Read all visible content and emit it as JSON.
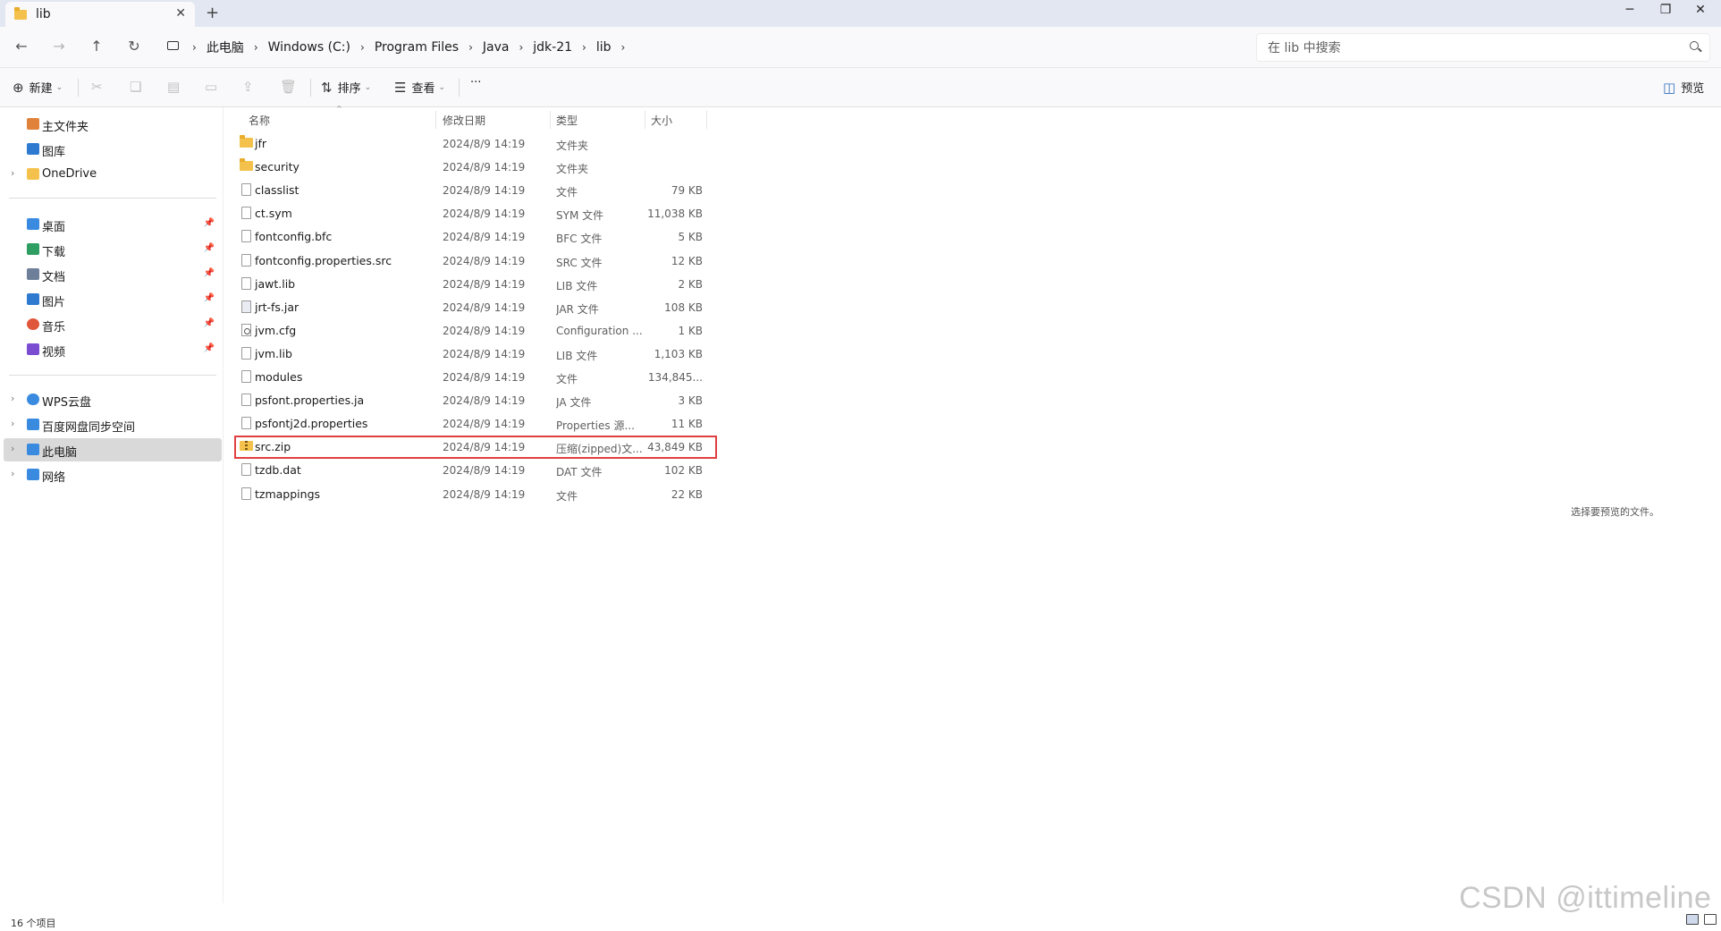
{
  "window": {
    "tab_title": "lib",
    "tab_close": "✕",
    "new_tab": "+",
    "minimize": "─",
    "restore": "❐",
    "close": "✕"
  },
  "address": {
    "crumbs": [
      "此电脑",
      "Windows (C:)",
      "Program Files",
      "Java",
      "jdk-21",
      "lib"
    ],
    "separator": "›",
    "search_placeholder": "在 lib 中搜索"
  },
  "toolbar": {
    "new_label": "新建",
    "sort_label": "排序",
    "view_label": "查看",
    "more_label": "···",
    "preview_label": "预览"
  },
  "sidebar": {
    "top_items": [
      {
        "label": "主文件夹",
        "icon": "home-icon",
        "color": "#e0823a"
      },
      {
        "label": "图库",
        "icon": "gallery-icon",
        "color": "#2f7ad1"
      },
      {
        "label": "OneDrive",
        "icon": "folder-icon",
        "color": "#f4c24c"
      }
    ],
    "pinned_items": [
      {
        "label": "桌面",
        "icon": "desktop-icon",
        "color": "#3a8be0"
      },
      {
        "label": "下载",
        "icon": "download-icon",
        "color": "#2e9e62"
      },
      {
        "label": "文档",
        "icon": "documents-icon",
        "color": "#6d7f99"
      },
      {
        "label": "图片",
        "icon": "pictures-icon",
        "color": "#2f7ad1"
      },
      {
        "label": "音乐",
        "icon": "music-icon",
        "color": "#e0563a"
      },
      {
        "label": "视频",
        "icon": "videos-icon",
        "color": "#7a4cd1"
      }
    ],
    "location_items": [
      {
        "label": "WPS云盘",
        "icon": "cloud-icon",
        "color": "#3a8be0"
      },
      {
        "label": "百度网盘同步空间",
        "icon": "sync-folder-icon",
        "color": "#3a8be0"
      },
      {
        "label": "此电脑",
        "icon": "this-pc-icon",
        "color": "#3a8be0"
      },
      {
        "label": "网络",
        "icon": "network-icon",
        "color": "#3a8be0"
      }
    ]
  },
  "columns": {
    "name": "名称",
    "date": "修改日期",
    "type": "类型",
    "size": "大小"
  },
  "files": [
    {
      "name": "jfr",
      "date": "2024/8/9 14:19",
      "type": "文件夹",
      "size": "",
      "icon": "folder"
    },
    {
      "name": "security",
      "date": "2024/8/9 14:19",
      "type": "文件夹",
      "size": "",
      "icon": "folder"
    },
    {
      "name": "classlist",
      "date": "2024/8/9 14:19",
      "type": "文件",
      "size": "79 KB",
      "icon": "file"
    },
    {
      "name": "ct.sym",
      "date": "2024/8/9 14:19",
      "type": "SYM 文件",
      "size": "11,038 KB",
      "icon": "file"
    },
    {
      "name": "fontconfig.bfc",
      "date": "2024/8/9 14:19",
      "type": "BFC 文件",
      "size": "5 KB",
      "icon": "file"
    },
    {
      "name": "fontconfig.properties.src",
      "date": "2024/8/9 14:19",
      "type": "SRC 文件",
      "size": "12 KB",
      "icon": "file"
    },
    {
      "name": "jawt.lib",
      "date": "2024/8/9 14:19",
      "type": "LIB 文件",
      "size": "2 KB",
      "icon": "file"
    },
    {
      "name": "jrt-fs.jar",
      "date": "2024/8/9 14:19",
      "type": "JAR 文件",
      "size": "108 KB",
      "icon": "jar"
    },
    {
      "name": "jvm.cfg",
      "date": "2024/8/9 14:19",
      "type": "Configuration ...",
      "size": "1 KB",
      "icon": "cfg"
    },
    {
      "name": "jvm.lib",
      "date": "2024/8/9 14:19",
      "type": "LIB 文件",
      "size": "1,103 KB",
      "icon": "file"
    },
    {
      "name": "modules",
      "date": "2024/8/9 14:19",
      "type": "文件",
      "size": "134,845...",
      "icon": "file"
    },
    {
      "name": "psfont.properties.ja",
      "date": "2024/8/9 14:19",
      "type": "JA 文件",
      "size": "3 KB",
      "icon": "file"
    },
    {
      "name": "psfontj2d.properties",
      "date": "2024/8/9 14:19",
      "type": "Properties 源...",
      "size": "11 KB",
      "icon": "file"
    },
    {
      "name": "src.zip",
      "date": "2024/8/9 14:19",
      "type": "压缩(zipped)文...",
      "size": "43,849 KB",
      "icon": "zip",
      "highlighted": true
    },
    {
      "name": "tzdb.dat",
      "date": "2024/8/9 14:19",
      "type": "DAT 文件",
      "size": "102 KB",
      "icon": "file"
    },
    {
      "name": "tzmappings",
      "date": "2024/8/9 14:19",
      "type": "文件",
      "size": "22 KB",
      "icon": "file"
    }
  ],
  "preview_message": "选择要预览的文件。",
  "status": {
    "item_count": "16 个项目"
  },
  "watermark": "CSDN @ittimeline",
  "colors": {
    "highlight_border": "#e04040",
    "selected_nav": "#d9d9d9",
    "folder": "#f4c24c"
  }
}
